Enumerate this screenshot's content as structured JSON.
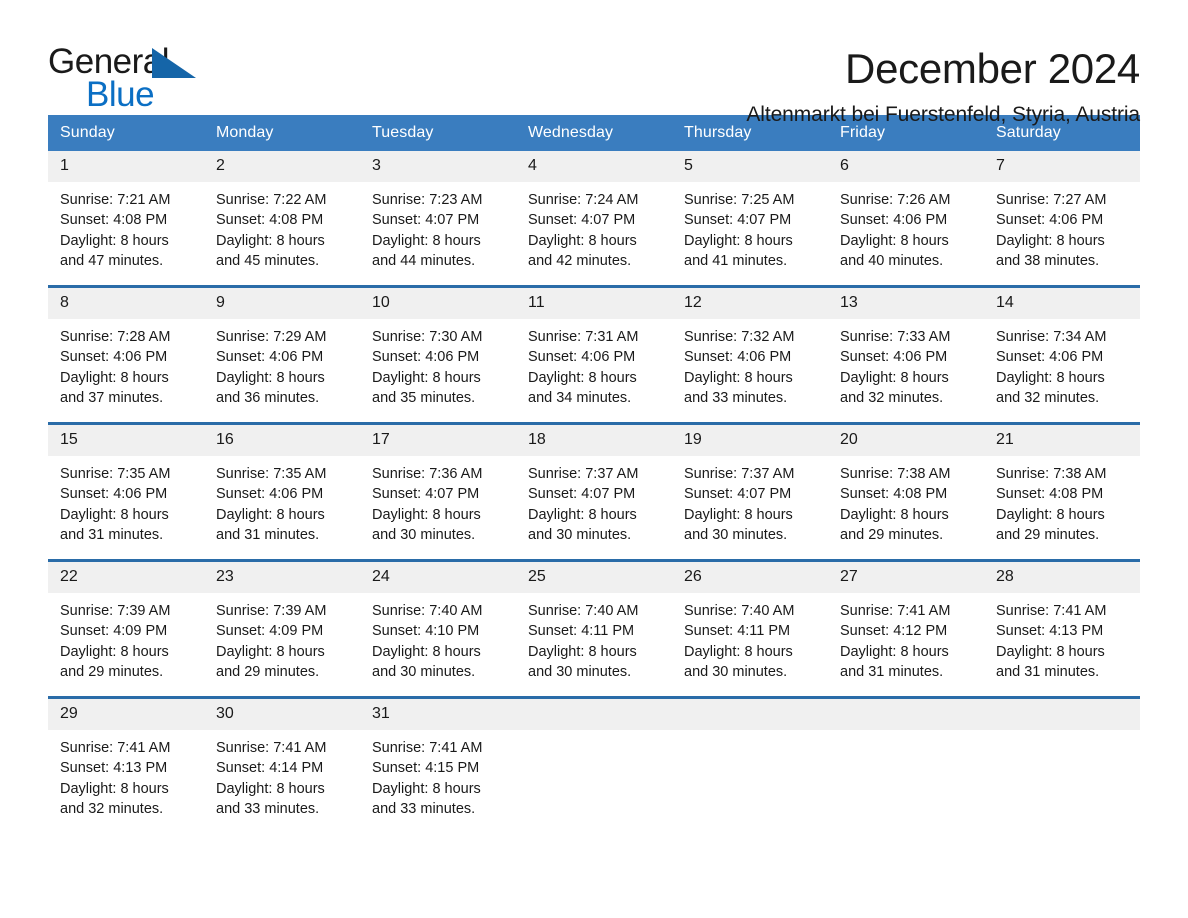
{
  "logo": {
    "word1": "General",
    "word2": "Blue",
    "triangle": "blue-triangle-icon",
    "accent": "#0b6fc4"
  },
  "header": {
    "title": "December 2024",
    "subtitle": "Altenmarkt bei Fuerstenfeld, Styria, Austria"
  },
  "theme": {
    "header_bg": "#3a7dbf",
    "row_rule": "#2a6ca8",
    "date_band": "#f0f0f0",
    "text": "#1a1a1a"
  },
  "calendar": {
    "weekdays": [
      "Sunday",
      "Monday",
      "Tuesday",
      "Wednesday",
      "Thursday",
      "Friday",
      "Saturday"
    ],
    "weeks": [
      [
        {
          "day": "1",
          "sunrise": "Sunrise: 7:21 AM",
          "sunset": "Sunset: 4:08 PM",
          "daylight1": "Daylight: 8 hours",
          "daylight2": "and 47 minutes."
        },
        {
          "day": "2",
          "sunrise": "Sunrise: 7:22 AM",
          "sunset": "Sunset: 4:08 PM",
          "daylight1": "Daylight: 8 hours",
          "daylight2": "and 45 minutes."
        },
        {
          "day": "3",
          "sunrise": "Sunrise: 7:23 AM",
          "sunset": "Sunset: 4:07 PM",
          "daylight1": "Daylight: 8 hours",
          "daylight2": "and 44 minutes."
        },
        {
          "day": "4",
          "sunrise": "Sunrise: 7:24 AM",
          "sunset": "Sunset: 4:07 PM",
          "daylight1": "Daylight: 8 hours",
          "daylight2": "and 42 minutes."
        },
        {
          "day": "5",
          "sunrise": "Sunrise: 7:25 AM",
          "sunset": "Sunset: 4:07 PM",
          "daylight1": "Daylight: 8 hours",
          "daylight2": "and 41 minutes."
        },
        {
          "day": "6",
          "sunrise": "Sunrise: 7:26 AM",
          "sunset": "Sunset: 4:06 PM",
          "daylight1": "Daylight: 8 hours",
          "daylight2": "and 40 minutes."
        },
        {
          "day": "7",
          "sunrise": "Sunrise: 7:27 AM",
          "sunset": "Sunset: 4:06 PM",
          "daylight1": "Daylight: 8 hours",
          "daylight2": "and 38 minutes."
        }
      ],
      [
        {
          "day": "8",
          "sunrise": "Sunrise: 7:28 AM",
          "sunset": "Sunset: 4:06 PM",
          "daylight1": "Daylight: 8 hours",
          "daylight2": "and 37 minutes."
        },
        {
          "day": "9",
          "sunrise": "Sunrise: 7:29 AM",
          "sunset": "Sunset: 4:06 PM",
          "daylight1": "Daylight: 8 hours",
          "daylight2": "and 36 minutes."
        },
        {
          "day": "10",
          "sunrise": "Sunrise: 7:30 AM",
          "sunset": "Sunset: 4:06 PM",
          "daylight1": "Daylight: 8 hours",
          "daylight2": "and 35 minutes."
        },
        {
          "day": "11",
          "sunrise": "Sunrise: 7:31 AM",
          "sunset": "Sunset: 4:06 PM",
          "daylight1": "Daylight: 8 hours",
          "daylight2": "and 34 minutes."
        },
        {
          "day": "12",
          "sunrise": "Sunrise: 7:32 AM",
          "sunset": "Sunset: 4:06 PM",
          "daylight1": "Daylight: 8 hours",
          "daylight2": "and 33 minutes."
        },
        {
          "day": "13",
          "sunrise": "Sunrise: 7:33 AM",
          "sunset": "Sunset: 4:06 PM",
          "daylight1": "Daylight: 8 hours",
          "daylight2": "and 32 minutes."
        },
        {
          "day": "14",
          "sunrise": "Sunrise: 7:34 AM",
          "sunset": "Sunset: 4:06 PM",
          "daylight1": "Daylight: 8 hours",
          "daylight2": "and 32 minutes."
        }
      ],
      [
        {
          "day": "15",
          "sunrise": "Sunrise: 7:35 AM",
          "sunset": "Sunset: 4:06 PM",
          "daylight1": "Daylight: 8 hours",
          "daylight2": "and 31 minutes."
        },
        {
          "day": "16",
          "sunrise": "Sunrise: 7:35 AM",
          "sunset": "Sunset: 4:06 PM",
          "daylight1": "Daylight: 8 hours",
          "daylight2": "and 31 minutes."
        },
        {
          "day": "17",
          "sunrise": "Sunrise: 7:36 AM",
          "sunset": "Sunset: 4:07 PM",
          "daylight1": "Daylight: 8 hours",
          "daylight2": "and 30 minutes."
        },
        {
          "day": "18",
          "sunrise": "Sunrise: 7:37 AM",
          "sunset": "Sunset: 4:07 PM",
          "daylight1": "Daylight: 8 hours",
          "daylight2": "and 30 minutes."
        },
        {
          "day": "19",
          "sunrise": "Sunrise: 7:37 AM",
          "sunset": "Sunset: 4:07 PM",
          "daylight1": "Daylight: 8 hours",
          "daylight2": "and 30 minutes."
        },
        {
          "day": "20",
          "sunrise": "Sunrise: 7:38 AM",
          "sunset": "Sunset: 4:08 PM",
          "daylight1": "Daylight: 8 hours",
          "daylight2": "and 29 minutes."
        },
        {
          "day": "21",
          "sunrise": "Sunrise: 7:38 AM",
          "sunset": "Sunset: 4:08 PM",
          "daylight1": "Daylight: 8 hours",
          "daylight2": "and 29 minutes."
        }
      ],
      [
        {
          "day": "22",
          "sunrise": "Sunrise: 7:39 AM",
          "sunset": "Sunset: 4:09 PM",
          "daylight1": "Daylight: 8 hours",
          "daylight2": "and 29 minutes."
        },
        {
          "day": "23",
          "sunrise": "Sunrise: 7:39 AM",
          "sunset": "Sunset: 4:09 PM",
          "daylight1": "Daylight: 8 hours",
          "daylight2": "and 29 minutes."
        },
        {
          "day": "24",
          "sunrise": "Sunrise: 7:40 AM",
          "sunset": "Sunset: 4:10 PM",
          "daylight1": "Daylight: 8 hours",
          "daylight2": "and 30 minutes."
        },
        {
          "day": "25",
          "sunrise": "Sunrise: 7:40 AM",
          "sunset": "Sunset: 4:11 PM",
          "daylight1": "Daylight: 8 hours",
          "daylight2": "and 30 minutes."
        },
        {
          "day": "26",
          "sunrise": "Sunrise: 7:40 AM",
          "sunset": "Sunset: 4:11 PM",
          "daylight1": "Daylight: 8 hours",
          "daylight2": "and 30 minutes."
        },
        {
          "day": "27",
          "sunrise": "Sunrise: 7:41 AM",
          "sunset": "Sunset: 4:12 PM",
          "daylight1": "Daylight: 8 hours",
          "daylight2": "and 31 minutes."
        },
        {
          "day": "28",
          "sunrise": "Sunrise: 7:41 AM",
          "sunset": "Sunset: 4:13 PM",
          "daylight1": "Daylight: 8 hours",
          "daylight2": "and 31 minutes."
        }
      ],
      [
        {
          "day": "29",
          "sunrise": "Sunrise: 7:41 AM",
          "sunset": "Sunset: 4:13 PM",
          "daylight1": "Daylight: 8 hours",
          "daylight2": "and 32 minutes."
        },
        {
          "day": "30",
          "sunrise": "Sunrise: 7:41 AM",
          "sunset": "Sunset: 4:14 PM",
          "daylight1": "Daylight: 8 hours",
          "daylight2": "and 33 minutes."
        },
        {
          "day": "31",
          "sunrise": "Sunrise: 7:41 AM",
          "sunset": "Sunset: 4:15 PM",
          "daylight1": "Daylight: 8 hours",
          "daylight2": "and 33 minutes."
        },
        {
          "day": "",
          "sunrise": "",
          "sunset": "",
          "daylight1": "",
          "daylight2": ""
        },
        {
          "day": "",
          "sunrise": "",
          "sunset": "",
          "daylight1": "",
          "daylight2": ""
        },
        {
          "day": "",
          "sunrise": "",
          "sunset": "",
          "daylight1": "",
          "daylight2": ""
        },
        {
          "day": "",
          "sunrise": "",
          "sunset": "",
          "daylight1": "",
          "daylight2": ""
        }
      ]
    ]
  }
}
